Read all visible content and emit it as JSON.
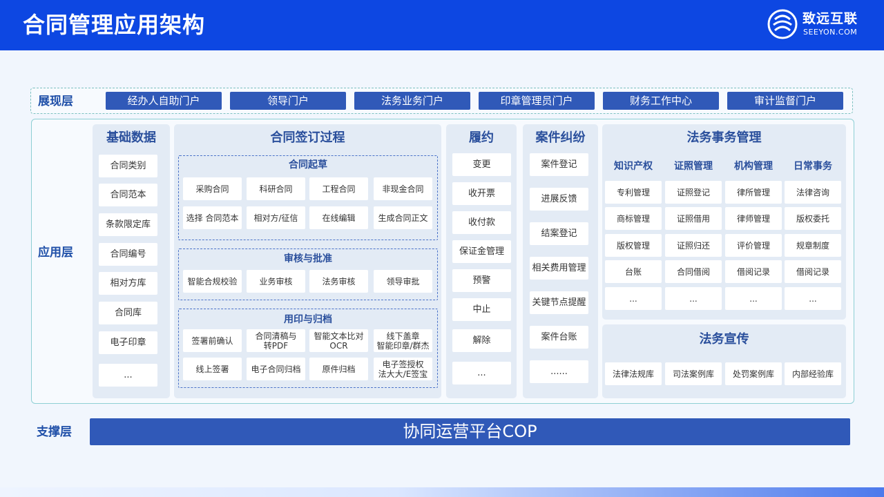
{
  "header": {
    "title": "合同管理应用架构",
    "logo": {
      "name": "致远互联",
      "sub": "SEEYON.COM"
    }
  },
  "layers": {
    "presentation": "展现层",
    "application": "应用层",
    "support": "支撑层"
  },
  "portals": [
    "经办人自助门户",
    "领导门户",
    "法务业务门户",
    "印章管理员门户",
    "财务工作中心",
    "审计监督门户"
  ],
  "basic_data": {
    "title": "基础数据",
    "items": [
      "合同类别",
      "合同范本",
      "条款限定库",
      "合同编号",
      "相对方库",
      "合同库",
      "电子印章",
      "..."
    ]
  },
  "signing": {
    "title": "合同签订过程",
    "drafting": {
      "title": "合同起草",
      "items": [
        "采购合同",
        "科研合同",
        "工程合同",
        "非现金合同",
        "选择 合同范本",
        "相对方/征信",
        "在线编辑",
        "生成合同正文"
      ]
    },
    "review": {
      "title": "审核与批准",
      "items": [
        "智能合规校验",
        "业务审核",
        "法务审核",
        "领导审批"
      ]
    },
    "seal": {
      "title": "用印与归档",
      "items": [
        "签署前确认",
        "合同清稿与\n转PDF",
        "智能文本比对\nOCR",
        "线下盖章\n智能印章/群杰",
        "线上签署",
        "电子合同归档",
        "原件归档",
        "电子签授权\n法大大/E签宝"
      ]
    }
  },
  "performance": {
    "title": "履约",
    "items": [
      "变更",
      "收开票",
      "收付款",
      "保证金管理",
      "预警",
      "中止",
      "解除",
      "..."
    ]
  },
  "dispute": {
    "title": "案件纠纷",
    "items": [
      "案件登记",
      "进展反馈",
      "结案登记",
      "相关费用管理",
      "关键节点提醒",
      "案件台账",
      "......"
    ]
  },
  "legal_affairs": {
    "title": "法务事务管理",
    "columns": [
      {
        "head": "知识产权",
        "items": [
          "专利管理",
          "商标管理",
          "版权管理",
          "台账",
          "..."
        ]
      },
      {
        "head": "证照管理",
        "items": [
          "证照登记",
          "证照借用",
          "证照归还",
          "合同借阅",
          "..."
        ]
      },
      {
        "head": "机构管理",
        "items": [
          "律所管理",
          "律师管理",
          "评价管理",
          "借阅记录",
          "..."
        ]
      },
      {
        "head": "日常事务",
        "items": [
          "法律咨询",
          "版权委托",
          "规章制度",
          "借阅记录",
          "..."
        ]
      }
    ]
  },
  "publicity": {
    "title": "法务宣传",
    "items": [
      "法律法规库",
      "司法案例库",
      "处罚案例库",
      "内部经验库"
    ]
  },
  "support_platform": "协同运营平台COP",
  "colors": {
    "header": "#0d47e2",
    "block": "#3059b8",
    "panel": "#e3ebf5",
    "title_text": "#2a4f9c"
  }
}
